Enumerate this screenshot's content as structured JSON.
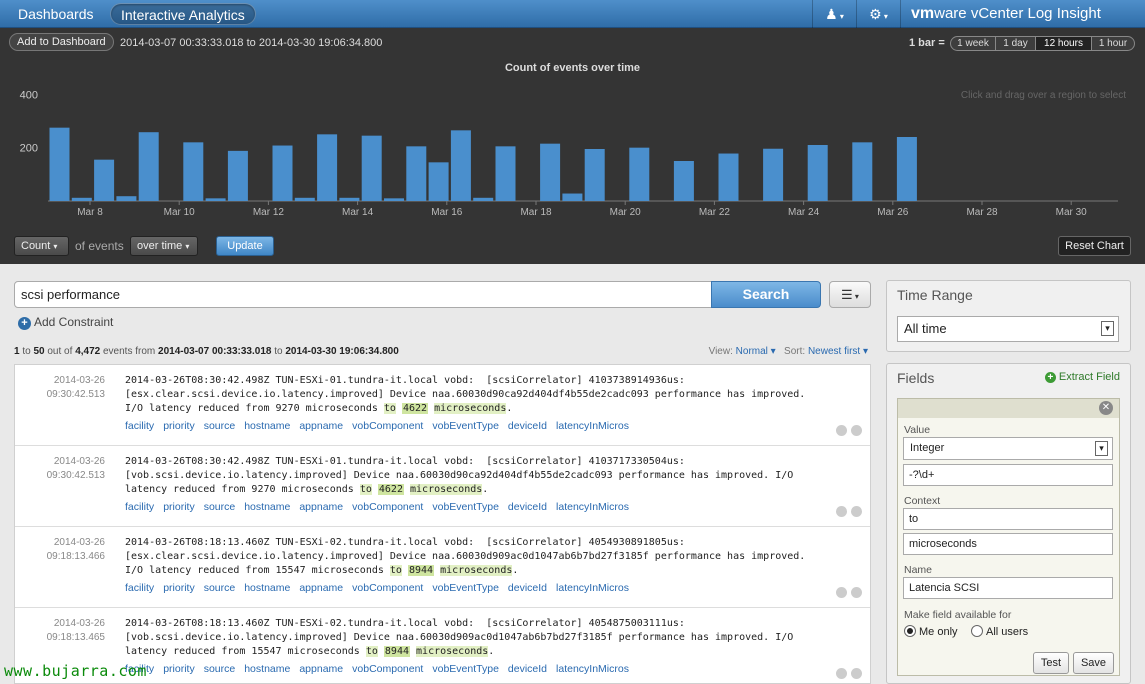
{
  "nav": {
    "tabs": [
      {
        "label": "Dashboards"
      },
      {
        "label": "Interactive Analytics"
      }
    ],
    "user_icon": "user-icon",
    "settings_icon": "gear-icon",
    "brand_vm": "vm",
    "brand_rest": "ware",
    "brand_product": "vCenter Log Insight"
  },
  "chart_panel": {
    "add_to_dashboard": "Add to Dashboard",
    "date_range": "2014-03-07 00:33:33.018 to 2014-03-30 19:06:34.800",
    "bar_label": "1 bar =",
    "bar_sizes": [
      {
        "label": "1 week",
        "active": false
      },
      {
        "label": "1 day",
        "active": false
      },
      {
        "label": "12 hours",
        "active": true
      },
      {
        "label": "1 hour",
        "active": false
      }
    ],
    "drag_hint": "Click and drag over a region to select",
    "controls": {
      "count": "Count",
      "of_events": "of events",
      "over_time": "over time",
      "update": "Update",
      "reset": "Reset Chart"
    }
  },
  "chart_data": {
    "type": "bar",
    "title": "Count of events over time",
    "xlabel": "",
    "ylabel": "",
    "ylim": [
      0,
      450
    ],
    "yticks": [
      200,
      400
    ],
    "xticks": [
      "Mar 8",
      "Mar 10",
      "Mar 12",
      "Mar 14",
      "Mar 16",
      "Mar 18",
      "Mar 20",
      "Mar 22",
      "Mar 24",
      "Mar 26",
      "Mar 28",
      "Mar 30"
    ],
    "color": "#4a8fcd",
    "bars": [
      {
        "t": 0,
        "v": 275
      },
      {
        "t": 0.5,
        "v": 12
      },
      {
        "t": 1,
        "v": 155
      },
      {
        "t": 1.5,
        "v": 18
      },
      {
        "t": 2,
        "v": 258
      },
      {
        "t": 3,
        "v": 220
      },
      {
        "t": 3.5,
        "v": 10
      },
      {
        "t": 4,
        "v": 188
      },
      {
        "t": 5,
        "v": 208
      },
      {
        "t": 5.5,
        "v": 12
      },
      {
        "t": 6,
        "v": 250
      },
      {
        "t": 6.5,
        "v": 12
      },
      {
        "t": 7,
        "v": 245
      },
      {
        "t": 7.5,
        "v": 10
      },
      {
        "t": 8,
        "v": 205
      },
      {
        "t": 8.5,
        "v": 145
      },
      {
        "t": 9,
        "v": 265
      },
      {
        "t": 9.5,
        "v": 12
      },
      {
        "t": 10,
        "v": 205
      },
      {
        "t": 11,
        "v": 215
      },
      {
        "t": 11.5,
        "v": 28
      },
      {
        "t": 12,
        "v": 195
      },
      {
        "t": 13,
        "v": 200
      },
      {
        "t": 14,
        "v": 150
      },
      {
        "t": 15,
        "v": 178
      },
      {
        "t": 16,
        "v": 196
      },
      {
        "t": 17,
        "v": 210
      },
      {
        "t": 18,
        "v": 220
      },
      {
        "t": 19,
        "v": 240
      }
    ]
  },
  "search": {
    "query": "scsi performance",
    "button": "Search",
    "menu_icon": "list-menu-icon",
    "add_constraint": "Add Constraint"
  },
  "results": {
    "range_from": "1",
    "range_to": "50",
    "out_of": "out of",
    "total": "4,472",
    "events_from": "events from",
    "start": "2014-03-07 00:33:33.018",
    "to": "to",
    "end": "2014-03-30 19:06:34.800",
    "view_label": "View:",
    "view_value": "Normal",
    "sort_label": "Sort:",
    "sort_value": "Newest first"
  },
  "events": [
    {
      "date": "2014-03-26",
      "time": "09:30:42.513",
      "line1": "2014-03-26T08:30:42.498Z TUN-ESXi-01.tundra-it.local vobd:  [scsiCorrelator] 4103738914936us:",
      "line2": "[esx.clear.scsi.device.io.latency.improved] Device naa.60030d90ca92d404df4b55de2cadc093 performance has improved.",
      "line3_pre": "I/O latency reduced from 9270 microseconds ",
      "hl_to": "to",
      "hl_value": "4622",
      "hl_unit": "microseconds",
      "line3_post": "."
    },
    {
      "date": "2014-03-26",
      "time": "09:30:42.513",
      "line1": "2014-03-26T08:30:42.498Z TUN-ESXi-01.tundra-it.local vobd:  [scsiCorrelator] 4103717330504us:",
      "line2": "[vob.scsi.device.io.latency.improved] Device naa.60030d90ca92d404df4b55de2cadc093 performance has improved. I/O",
      "line3_pre": "latency reduced from 9270 microseconds ",
      "hl_to": "to",
      "hl_value": "4622",
      "hl_unit": "microseconds",
      "line3_post": "."
    },
    {
      "date": "2014-03-26",
      "time": "09:18:13.466",
      "line1": "2014-03-26T08:18:13.460Z TUN-ESXi-02.tundra-it.local vobd:  [scsiCorrelator] 4054930891805us:",
      "line2": "[esx.clear.scsi.device.io.latency.improved] Device naa.60030d909ac0d1047ab6b7bd27f3185f performance has improved.",
      "line3_pre": "I/O latency reduced from 15547 microseconds ",
      "hl_to": "to",
      "hl_value": "8944",
      "hl_unit": "microseconds",
      "line3_post": "."
    },
    {
      "date": "2014-03-26",
      "time": "09:18:13.465",
      "line1": "2014-03-26T08:18:13.460Z TUN-ESXi-02.tundra-it.local vobd:  [scsiCorrelator] 4054875003111us:",
      "line2": "[vob.scsi.device.io.latency.improved] Device naa.60030d909ac0d1047ab6b7bd27f3185f performance has improved. I/O",
      "line3_pre": "latency reduced from 15547 microseconds ",
      "hl_to": "to",
      "hl_value": "8944",
      "hl_unit": "microseconds",
      "line3_post": "."
    }
  ],
  "event_fields": [
    "facility",
    "priority",
    "source",
    "hostname",
    "appname",
    "vobComponent",
    "vobEventType",
    "deviceId",
    "latencyInMicros"
  ],
  "sidebar": {
    "time_range": {
      "title": "Time Range",
      "value": "All time"
    },
    "fields": {
      "title": "Fields",
      "extract": "Extract Field",
      "value_label": "Value",
      "value_type": "Integer",
      "regex": "-?\\d+",
      "context_label": "Context",
      "context_before": "to",
      "context_after": "microseconds",
      "name_label": "Name",
      "name_value": "Latencia SCSI",
      "availability_label": "Make field available for",
      "opt_me": "Me only",
      "opt_all": "All users",
      "test": "Test",
      "save": "Save"
    }
  },
  "watermark": "www.bujarra.com"
}
